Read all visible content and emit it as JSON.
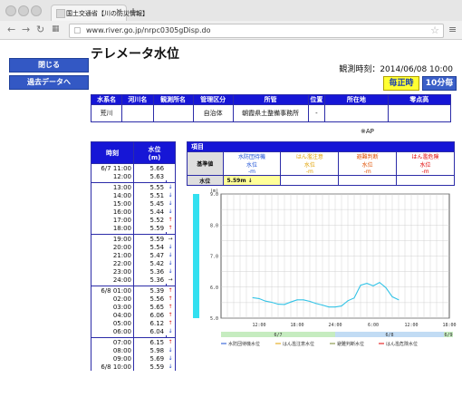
{
  "browser": {
    "tab_title": "国土交通省【川の防災情報】",
    "url": "www.river.go.jp/nrpc0305gDisp.do"
  },
  "page": {
    "title": "テレメータ水位",
    "close_button": "閉じる",
    "past_data_button": "過去データへ",
    "obs_time": "観測時刻：2014/06/08 10:00",
    "hourly_button": "毎正時",
    "ten_min_button": "10分毎"
  },
  "info_table": {
    "headers": [
      "水系名",
      "河川名",
      "観測所名",
      "管理区分",
      "所管",
      "位置",
      "所在地",
      "零点高"
    ],
    "values": [
      "荒川",
      "",
      "",
      "自治体",
      "朝霞県土整備事務所",
      "-",
      "",
      ""
    ]
  },
  "note": "※AP",
  "left_table": {
    "headers": [
      "時刻",
      "水位\n(m)"
    ],
    "groups": [
      [
        [
          "6/7 11:00",
          "5.66",
          ""
        ],
        [
          "12:00",
          "5.63",
          ""
        ]
      ],
      [
        [
          "13:00",
          "5.55",
          "↓"
        ],
        [
          "14:00",
          "5.51",
          "↓"
        ],
        [
          "15:00",
          "5.45",
          "↓"
        ],
        [
          "16:00",
          "5.44",
          "↓"
        ],
        [
          "17:00",
          "5.52",
          "↑"
        ],
        [
          "18:00",
          "5.59",
          "↑"
        ]
      ],
      [
        [
          "19:00",
          "5.59",
          "→"
        ],
        [
          "20:00",
          "5.54",
          "↓"
        ],
        [
          "21:00",
          "5.47",
          "↓"
        ],
        [
          "22:00",
          "5.42",
          "↓"
        ],
        [
          "23:00",
          "5.36",
          "↓"
        ],
        [
          "24:00",
          "5.36",
          "→"
        ]
      ],
      [
        [
          "6/8 01:00",
          "5.39",
          "↑"
        ],
        [
          "02:00",
          "5.56",
          "↑"
        ],
        [
          "03:00",
          "5.65",
          "↑"
        ],
        [
          "04:00",
          "6.06",
          "↑"
        ],
        [
          "05:00",
          "6.12",
          "↑"
        ],
        [
          "06:00",
          "6.04",
          "↓"
        ]
      ],
      [
        [
          "07:00",
          "6.15",
          "↑"
        ],
        [
          "08:00",
          "5.98",
          "↓"
        ],
        [
          "09:00",
          "5.69",
          "↓"
        ],
        [
          "6/8 10:00",
          "5.59",
          "↓"
        ]
      ]
    ]
  },
  "right_table": {
    "header": "項目",
    "kijun_label": "基準値",
    "kijun_cols": [
      {
        "name": "水防団待機\n水位",
        "val": "-m",
        "color": "#1a4fd6"
      },
      {
        "name": "はん濫注意\n水位",
        "val": "-m",
        "color": "#e0a000"
      },
      {
        "name": "避難判断\n水位",
        "val": "-m",
        "color": "#e05000"
      },
      {
        "name": "はん濫危険\n水位",
        "val": "-m",
        "color": "#e00000"
      }
    ],
    "level_label": "水位",
    "level_value": "5.59m ↓"
  },
  "chart_data": {
    "type": "line",
    "y_unit": "(m)",
    "ylim": [
      5.0,
      9.0
    ],
    "y_ticks": [
      "9.0",
      "8.0",
      "7.0",
      "6.0",
      "5.0"
    ],
    "x_ticks": [
      "12:00",
      "18:00",
      "24:00",
      "6:00",
      "12:00",
      "18:00"
    ],
    "date_labels": [
      "6/7",
      "6/8",
      "6/9"
    ],
    "legend": [
      "水防団待機水位",
      "はん濫注意水位",
      "避難判断水位",
      "はん濫危険水位"
    ],
    "legend_colors": [
      "#1a4fd6",
      "#e0a000",
      "#7a8a30",
      "#e00000"
    ],
    "series": [
      {
        "values": [
          [
            11,
            5.66
          ],
          [
            12,
            5.63
          ],
          [
            13,
            5.55
          ],
          [
            14,
            5.51
          ],
          [
            15,
            5.45
          ],
          [
            16,
            5.44
          ],
          [
            17,
            5.52
          ],
          [
            18,
            5.59
          ],
          [
            19,
            5.59
          ],
          [
            20,
            5.54
          ],
          [
            21,
            5.47
          ],
          [
            22,
            5.42
          ],
          [
            23,
            5.36
          ],
          [
            24,
            5.36
          ],
          [
            25,
            5.39
          ],
          [
            26,
            5.56
          ],
          [
            27,
            5.65
          ],
          [
            28,
            6.06
          ],
          [
            29,
            6.12
          ],
          [
            30,
            6.04
          ],
          [
            31,
            6.15
          ],
          [
            32,
            5.98
          ],
          [
            33,
            5.69
          ],
          [
            34,
            5.59
          ]
        ],
        "color": "#33c3e6"
      }
    ],
    "grid": true
  }
}
